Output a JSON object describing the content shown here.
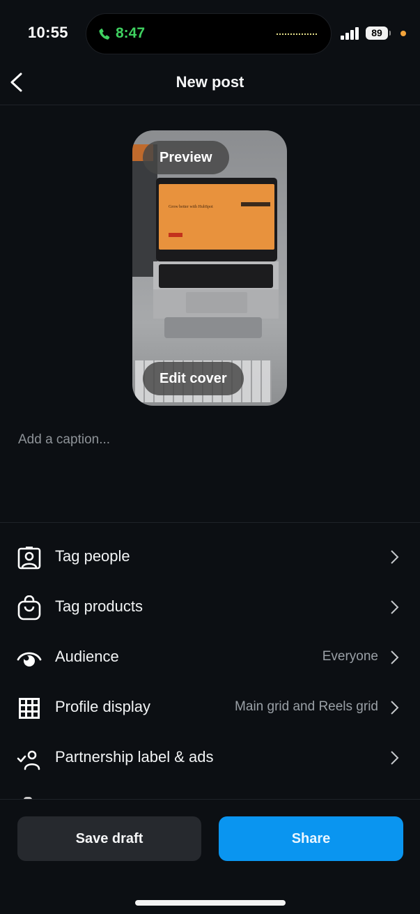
{
  "status_bar": {
    "time": "10:55",
    "call_duration": "8:47",
    "battery_level": "89",
    "icons": [
      "phone-call-icon",
      "audio-waveform-icon",
      "cellular-signal-icon",
      "battery-icon",
      "privacy-indicator-dot"
    ],
    "colors": {
      "call": "#3fd160",
      "privacy_dot": "#f3a33a"
    }
  },
  "header": {
    "title": "New post",
    "back_icon": "chevron-left-icon"
  },
  "media": {
    "preview_label": "Preview",
    "edit_cover_label": "Edit cover",
    "screen_headline": "Grow better with HubSpot"
  },
  "caption": {
    "placeholder": "Add a caption...",
    "value": ""
  },
  "options": [
    {
      "label": "Tag people",
      "value": "",
      "icon": "tag-people-icon"
    },
    {
      "label": "Tag products",
      "value": "",
      "icon": "shopping-bag-icon"
    },
    {
      "label": "Audience",
      "value": "Everyone",
      "icon": "eye-icon"
    },
    {
      "label": "Profile display",
      "value": "Main grid and Reels grid",
      "icon": "grid-icon"
    },
    {
      "label": "Partnership label & ads",
      "value": "",
      "icon": "partnership-icon"
    }
  ],
  "footer": {
    "save_draft_label": "Save draft",
    "share_label": "Share",
    "colors": {
      "share": "#0a95f0",
      "save_draft": "#26292e"
    }
  }
}
